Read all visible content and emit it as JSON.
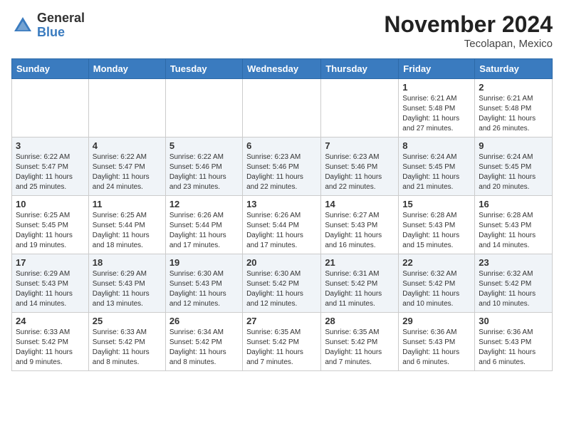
{
  "header": {
    "logo_general": "General",
    "logo_blue": "Blue",
    "month_year": "November 2024",
    "location": "Tecolapan, Mexico"
  },
  "days_of_week": [
    "Sunday",
    "Monday",
    "Tuesday",
    "Wednesday",
    "Thursday",
    "Friday",
    "Saturday"
  ],
  "weeks": [
    [
      {
        "day": "",
        "info": ""
      },
      {
        "day": "",
        "info": ""
      },
      {
        "day": "",
        "info": ""
      },
      {
        "day": "",
        "info": ""
      },
      {
        "day": "",
        "info": ""
      },
      {
        "day": "1",
        "info": "Sunrise: 6:21 AM\nSunset: 5:48 PM\nDaylight: 11 hours\nand 27 minutes."
      },
      {
        "day": "2",
        "info": "Sunrise: 6:21 AM\nSunset: 5:48 PM\nDaylight: 11 hours\nand 26 minutes."
      }
    ],
    [
      {
        "day": "3",
        "info": "Sunrise: 6:22 AM\nSunset: 5:47 PM\nDaylight: 11 hours\nand 25 minutes."
      },
      {
        "day": "4",
        "info": "Sunrise: 6:22 AM\nSunset: 5:47 PM\nDaylight: 11 hours\nand 24 minutes."
      },
      {
        "day": "5",
        "info": "Sunrise: 6:22 AM\nSunset: 5:46 PM\nDaylight: 11 hours\nand 23 minutes."
      },
      {
        "day": "6",
        "info": "Sunrise: 6:23 AM\nSunset: 5:46 PM\nDaylight: 11 hours\nand 22 minutes."
      },
      {
        "day": "7",
        "info": "Sunrise: 6:23 AM\nSunset: 5:46 PM\nDaylight: 11 hours\nand 22 minutes."
      },
      {
        "day": "8",
        "info": "Sunrise: 6:24 AM\nSunset: 5:45 PM\nDaylight: 11 hours\nand 21 minutes."
      },
      {
        "day": "9",
        "info": "Sunrise: 6:24 AM\nSunset: 5:45 PM\nDaylight: 11 hours\nand 20 minutes."
      }
    ],
    [
      {
        "day": "10",
        "info": "Sunrise: 6:25 AM\nSunset: 5:45 PM\nDaylight: 11 hours\nand 19 minutes."
      },
      {
        "day": "11",
        "info": "Sunrise: 6:25 AM\nSunset: 5:44 PM\nDaylight: 11 hours\nand 18 minutes."
      },
      {
        "day": "12",
        "info": "Sunrise: 6:26 AM\nSunset: 5:44 PM\nDaylight: 11 hours\nand 17 minutes."
      },
      {
        "day": "13",
        "info": "Sunrise: 6:26 AM\nSunset: 5:44 PM\nDaylight: 11 hours\nand 17 minutes."
      },
      {
        "day": "14",
        "info": "Sunrise: 6:27 AM\nSunset: 5:43 PM\nDaylight: 11 hours\nand 16 minutes."
      },
      {
        "day": "15",
        "info": "Sunrise: 6:28 AM\nSunset: 5:43 PM\nDaylight: 11 hours\nand 15 minutes."
      },
      {
        "day": "16",
        "info": "Sunrise: 6:28 AM\nSunset: 5:43 PM\nDaylight: 11 hours\nand 14 minutes."
      }
    ],
    [
      {
        "day": "17",
        "info": "Sunrise: 6:29 AM\nSunset: 5:43 PM\nDaylight: 11 hours\nand 14 minutes."
      },
      {
        "day": "18",
        "info": "Sunrise: 6:29 AM\nSunset: 5:43 PM\nDaylight: 11 hours\nand 13 minutes."
      },
      {
        "day": "19",
        "info": "Sunrise: 6:30 AM\nSunset: 5:43 PM\nDaylight: 11 hours\nand 12 minutes."
      },
      {
        "day": "20",
        "info": "Sunrise: 6:30 AM\nSunset: 5:42 PM\nDaylight: 11 hours\nand 12 minutes."
      },
      {
        "day": "21",
        "info": "Sunrise: 6:31 AM\nSunset: 5:42 PM\nDaylight: 11 hours\nand 11 minutes."
      },
      {
        "day": "22",
        "info": "Sunrise: 6:32 AM\nSunset: 5:42 PM\nDaylight: 11 hours\nand 10 minutes."
      },
      {
        "day": "23",
        "info": "Sunrise: 6:32 AM\nSunset: 5:42 PM\nDaylight: 11 hours\nand 10 minutes."
      }
    ],
    [
      {
        "day": "24",
        "info": "Sunrise: 6:33 AM\nSunset: 5:42 PM\nDaylight: 11 hours\nand 9 minutes."
      },
      {
        "day": "25",
        "info": "Sunrise: 6:33 AM\nSunset: 5:42 PM\nDaylight: 11 hours\nand 8 minutes."
      },
      {
        "day": "26",
        "info": "Sunrise: 6:34 AM\nSunset: 5:42 PM\nDaylight: 11 hours\nand 8 minutes."
      },
      {
        "day": "27",
        "info": "Sunrise: 6:35 AM\nSunset: 5:42 PM\nDaylight: 11 hours\nand 7 minutes."
      },
      {
        "day": "28",
        "info": "Sunrise: 6:35 AM\nSunset: 5:42 PM\nDaylight: 11 hours\nand 7 minutes."
      },
      {
        "day": "29",
        "info": "Sunrise: 6:36 AM\nSunset: 5:43 PM\nDaylight: 11 hours\nand 6 minutes."
      },
      {
        "day": "30",
        "info": "Sunrise: 6:36 AM\nSunset: 5:43 PM\nDaylight: 11 hours\nand 6 minutes."
      }
    ]
  ]
}
